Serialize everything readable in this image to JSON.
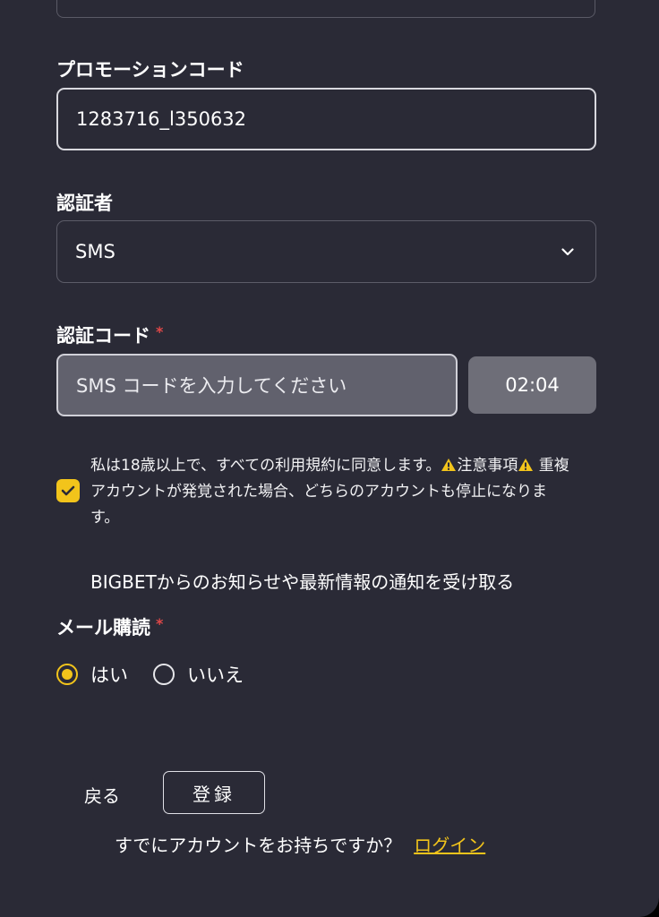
{
  "form": {
    "promo": {
      "label": "プロモーションコード",
      "value": "1283716_l350632"
    },
    "auth_method": {
      "label": "認証者",
      "selected": "SMS"
    },
    "auth_code": {
      "label": "認証コード",
      "required_mark": "*",
      "placeholder": "SMS コードを入力してください",
      "timer": "02:04"
    },
    "terms": {
      "checked": true,
      "text_part1": "私は18歳以上で、すべての利用規約に同意します。",
      "text_part2": "注意事項",
      "text_part3": " 重複アカウントが発覚された場合、どちらのアカウントも停止になります。"
    },
    "notice": "BIGBETからのお知らせや最新情報の通知を受け取る",
    "mail": {
      "label": "メール購読",
      "required_mark": "*",
      "options": [
        {
          "label": "はい",
          "selected": true
        },
        {
          "label": "いいえ",
          "selected": false
        }
      ]
    }
  },
  "actions": {
    "back_label": "戻る",
    "register_label": "登録",
    "login_prompt": "すでにアカウントをお持ちですか？",
    "login_link": "ログイン"
  },
  "colors": {
    "background": "#2a2a36",
    "accent": "#f2c41b",
    "required": "#e04848"
  }
}
